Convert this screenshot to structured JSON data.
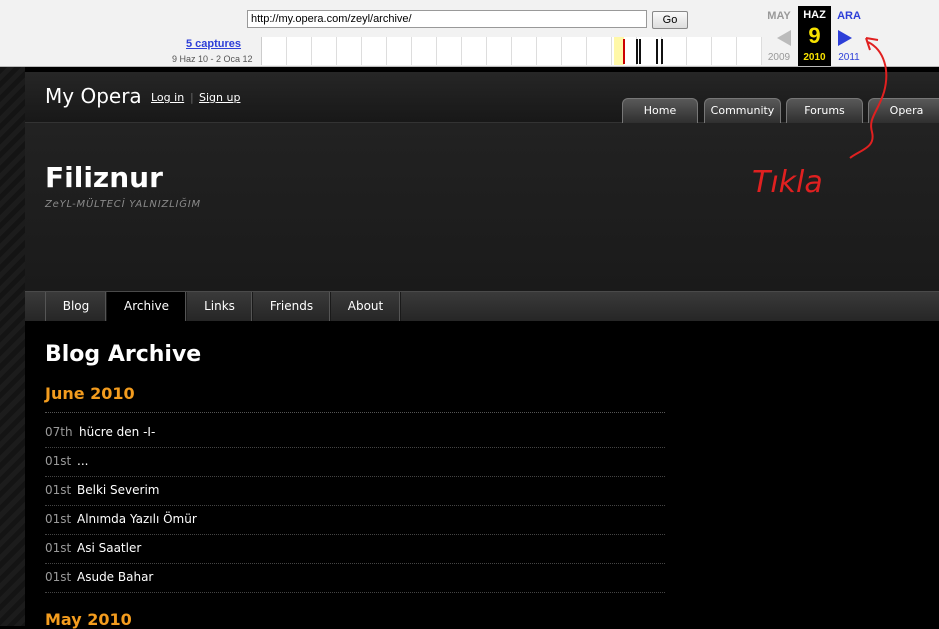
{
  "wayback": {
    "url": "http://my.opera.com/zeyl/archive/",
    "go_label": "Go",
    "captures_label": "5 captures",
    "date_range": "9 Haz 10 - 2 Oca 12",
    "prev_month": "MAY",
    "prev_year": "2009",
    "current_month": "HAZ",
    "current_day": "9",
    "current_year": "2010",
    "next_month": "ARA",
    "next_year": "2011",
    "colors": {
      "link": "#2d3fd8",
      "highlight": "#f7e200",
      "inactive": "#999999"
    }
  },
  "opera": {
    "brand": "My Opera",
    "login": "Log in",
    "signup": "Sign up",
    "nav_tabs": [
      "Home",
      "Community",
      "Forums",
      "Opera"
    ]
  },
  "blog": {
    "title": "Filiznur",
    "subtitle": "ZeYL-MÜLTECİ YALNIZLIĞIM"
  },
  "subnav": {
    "tabs": [
      "Blog",
      "Archive",
      "Links",
      "Friends",
      "About"
    ],
    "active": "Archive"
  },
  "archive": {
    "page_title": "Blog Archive",
    "months": [
      {
        "name": "June 2010",
        "posts": [
          {
            "day": "07th",
            "title": "hücre den -I-"
          },
          {
            "day": "01st",
            "title": "..."
          },
          {
            "day": "01st",
            "title": "Belki Severim"
          },
          {
            "day": "01st",
            "title": "Alnımda Yazılı Ömür"
          },
          {
            "day": "01st",
            "title": "Asi Saatler"
          },
          {
            "day": "01st",
            "title": "Asude Bahar"
          }
        ]
      },
      {
        "name": "May 2010"
      }
    ],
    "accent_color": "#f39c1e"
  },
  "annotation": {
    "text": "Tıkla",
    "color": "#e02020"
  }
}
